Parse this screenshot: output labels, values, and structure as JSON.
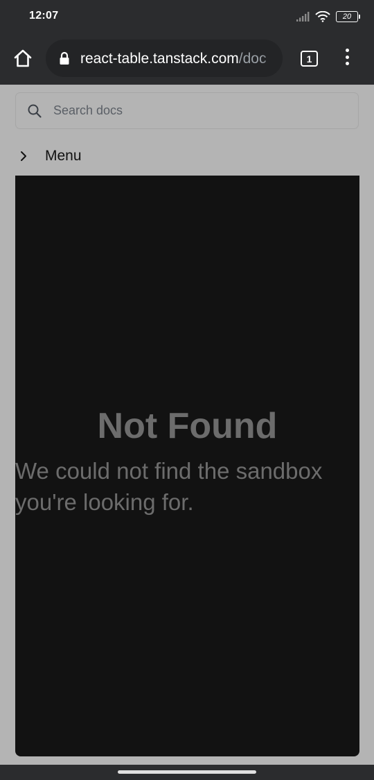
{
  "status_bar": {
    "time": "12:07",
    "battery_level": "20",
    "icons": [
      "signal-icon",
      "wifi-icon",
      "battery-icon"
    ]
  },
  "browser": {
    "url_domain": "react-table.tanstack.com",
    "url_path": "/doc",
    "tab_count": "1",
    "icons": [
      "home-icon",
      "lock-icon",
      "more-icon"
    ]
  },
  "search": {
    "placeholder": "Search docs"
  },
  "menu": {
    "label": "Menu"
  },
  "sandbox": {
    "title": "Not Found",
    "message": "We could not find the sandbox you're looking for."
  },
  "colors": {
    "chrome": "#2b2c2e",
    "page_background": "#b4b4b4",
    "sandbox_background": "#121212",
    "sandbox_text": "#6c6c6c"
  }
}
